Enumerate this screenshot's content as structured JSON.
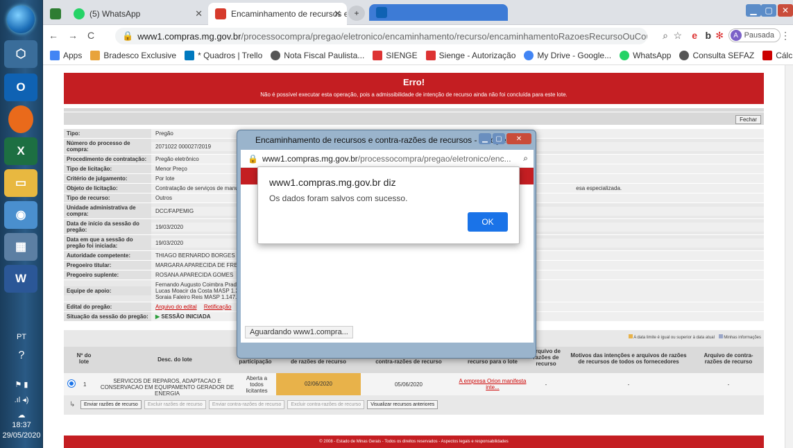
{
  "taskbar": {
    "lang": "PT",
    "time": "18:37",
    "date": "29/05/2020"
  },
  "browser": {
    "tabs": [
      {
        "label": "(5) WhatsApp"
      },
      {
        "label": "Encaminhamento de recursos e c"
      }
    ],
    "url_domain": "www1.compras.mg.gov.br",
    "url_path": "/processocompra/pregao/eletronico/encaminhamento/recurso/encaminhamentoRazoesRecursoOuContraRaz...",
    "profile_label": "Pausada",
    "profile_initial": "A",
    "bookmarks": [
      {
        "label": "Apps",
        "color": "#4285f4"
      },
      {
        "label": "Bradesco Exclusive",
        "color": "#e8a33b"
      },
      {
        "label": "* Quadros | Trello",
        "color": "#0079bf"
      },
      {
        "label": "Nota Fiscal Paulista...",
        "color": "#555"
      },
      {
        "label": "SIENGE",
        "color": "#d33"
      },
      {
        "label": "Sienge - Autorização",
        "color": "#d33"
      },
      {
        "label": "My Drive - Google...",
        "color": "#4285f4"
      },
      {
        "label": "WhatsApp",
        "color": "#25d366"
      },
      {
        "label": "Consulta SEFAZ",
        "color": "#555"
      },
      {
        "label": "Cálculo Exato - Atu...",
        "color": "#c00"
      }
    ],
    "more": "»"
  },
  "page": {
    "error_title": "Erro!",
    "error_msg": "Não é possível executar esta operação, pois a admissibilidade de intenção de recurso ainda não foi concluída para este lote.",
    "close_label": "Fechar",
    "info_rows": [
      {
        "k": "Tipo:",
        "v": "Pregão"
      },
      {
        "k": "Número do processo de compra:",
        "v": "2071022 000027/2019"
      },
      {
        "k": "Procedimento de contratação:",
        "v": "Pregão eletrônico"
      },
      {
        "k": "Tipo de licitação:",
        "v": "Menor Preço"
      },
      {
        "k": "Critério de julgamento:",
        "v": "Por lote"
      },
      {
        "k": "Objeto de licitação:",
        "v": "Contratação de serviços de manute",
        "v2": "esa especializada."
      },
      {
        "k": "Tipo de recurso:",
        "v": "Outros"
      },
      {
        "k": "Unidade administrativa de compra:",
        "v": "DCC/FAPEMIG"
      },
      {
        "k": "Data de início da sessão do pregão:",
        "v": "19/03/2020"
      },
      {
        "k": "Data em que a sessão do pregão foi iniciada:",
        "v": "19/03/2020"
      },
      {
        "k": "Autoridade competente:",
        "v": "THIAGO BERNARDO BORGES"
      },
      {
        "k": "Pregoeiro titular:",
        "v": "MARGARA APARECIDA DE FREITAS"
      },
      {
        "k": "Pregoeiro suplente:",
        "v": "ROSANA APARECIDA GOMES"
      },
      {
        "k": "Equipe de apoio:",
        "v": "Fernando Augusto Coimbra Prado",
        "v3": "Lucas Moacir da Costa MASP 1.33",
        "v4": "Soraia Faleiro Reis MASP 1.147.93"
      },
      {
        "k": "Edital do pregão:",
        "v": "Arquivo do edital",
        "v2": "Retificação"
      },
      {
        "k": "Situação da sessão do pregão:",
        "v": "SESSÃO INICIADA"
      }
    ],
    "legend1": "A data limite é igual ou superior à data atual",
    "legend2": "Minhas informações",
    "headers": {
      "lote": "Nº do lote",
      "desc": "Desc. do lote",
      "regra": "Regra de participação",
      "data_razoes": "Data limite para apresentação de razões de recurso",
      "data_contra": "Data limite para apresentação de contra-razões de recurso",
      "motivo": "Motivo da intenção de recurso para o lote",
      "arquivo": "Arquivo de razões de recurso",
      "motivos_todos": "Motivos das intenções e arquivos de razões de recursos de todos os fornecedores",
      "arquivo_contra": "Arquivo de contra-razões de recurso"
    },
    "row": {
      "lote": "1",
      "desc": "SERVICOS DE REPAROS, ADAPTACAO E CONSERVACAO EM EQUIPAMENTO GERADOR DE ENERGIA",
      "regra": "Aberta a todos licitantes",
      "data_razoes": "02/06/2020",
      "data_contra": "05/06/2020",
      "motivo": "A empresa Orion manifesta inte...",
      "arquivo": "-",
      "motivos_todos": "-",
      "arquivo_contra": "-"
    },
    "buttons": [
      {
        "label": "Enviar razões de recurso",
        "enabled": true
      },
      {
        "label": "Excluir razões de recurso",
        "enabled": false
      },
      {
        "label": "Enviar contra-razões de recurso",
        "enabled": false
      },
      {
        "label": "Excluir contra-razões de recurso",
        "enabled": false
      },
      {
        "label": "Visualizar recursos anteriores",
        "enabled": true
      }
    ],
    "footer": "© 2008 - Estado de Minas Gerais - Todos os direitos reservados - Aspectos legais e responsabilidades"
  },
  "popup": {
    "title": "Encaminhamento de recursos e contra-razões de recursos - Google ...",
    "url_domain": "www1.compras.mg.gov.br",
    "url_path": "/processocompra/pregao/eletronico/enc...",
    "status": "Aguardando www1.compra..."
  },
  "alert": {
    "heading": "www1.compras.mg.gov.br diz",
    "message": "Os dados foram salvos com sucesso.",
    "ok": "OK"
  }
}
